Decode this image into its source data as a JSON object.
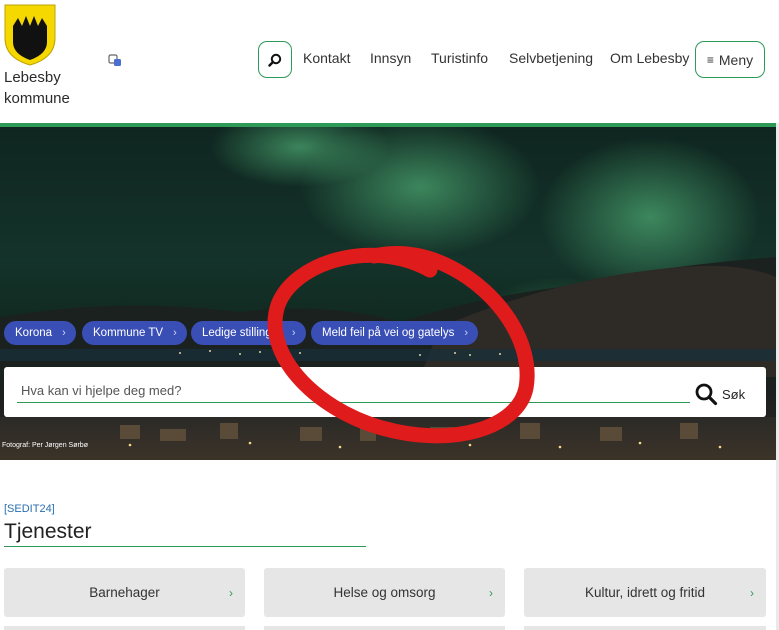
{
  "header": {
    "brand_line1": "Lebesby",
    "brand_line2": "kommune",
    "nav": [
      "Kontakt",
      "Innsyn",
      "Turistinfo",
      "Selvbetjening",
      "Om Lebesby"
    ],
    "menu_label": "Meny"
  },
  "hero": {
    "quick_links": [
      "Korona",
      "Kommune TV",
      "Ledige stillinger",
      "Meld feil på vei og gatelys"
    ],
    "search_placeholder": "Hva kan vi hjelpe deg med?",
    "search_button": "Søk",
    "photo_credit": "Fotograf: Per Jørgen Sørbø"
  },
  "content": {
    "edit_tag": "[SEDIT24]",
    "section_title": "Tjenester",
    "cards": [
      "Barnehager",
      "Helse og omsorg",
      "Kultur, idrett og fritid"
    ]
  },
  "colors": {
    "accent_green": "#2e9a57",
    "quick_link_blue": "#3a4fb5",
    "annotation_red": "#e01b1b"
  },
  "icons": {
    "logo": "coat-of-arms",
    "translate": "translate-icon",
    "search": "magnifier-icon",
    "menu": "hamburger-icon",
    "chevron": "chevron-right-icon"
  }
}
